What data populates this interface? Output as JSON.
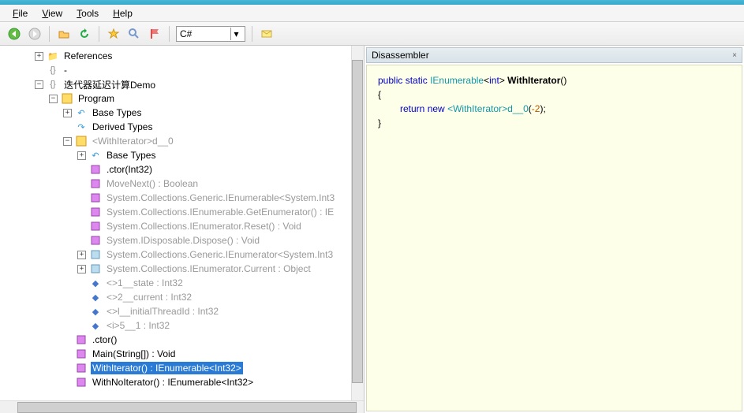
{
  "menu": {
    "file": "File",
    "view": "View",
    "tools": "Tools",
    "help": "Help"
  },
  "toolbar": {
    "combo_value": "C#"
  },
  "tree": {
    "references": "References",
    "dash": "-",
    "demo": "迭代器延迟计算Demo",
    "program": "Program",
    "base_types": "Base Types",
    "derived_types": "Derived Types",
    "withiterator_class": "<WithIterator>d__0",
    "base_types2": "Base Types",
    "ctor_int": ".ctor(Int32)",
    "movenext": "MoveNext() : Boolean",
    "sys_gen_ienum": "System.Collections.Generic.IEnumerable<System.Int3",
    "sys_ienum_get": "System.Collections.IEnumerable.GetEnumerator() : IE",
    "sys_ienum_reset": "System.Collections.IEnumerator.Reset() : Void",
    "sys_idisp": "System.IDisposable.Dispose() : Void",
    "sys_gen_ienumtr": "System.Collections.Generic.IEnumerator<System.Int3",
    "sys_ienum_cur": "System.Collections.IEnumerator.Current : Object",
    "state": "<>1__state : Int32",
    "current": "<>2__current : Int32",
    "threadid": "<>l__initialThreadId : Int32",
    "i5": "<i>5__1 : Int32",
    "ctor": ".ctor()",
    "main": "Main(String[]) : Void",
    "withiterator": "WithIterator() : IEnumerable<Int32>",
    "withnoiterator": "WithNoIterator() : IEnumerable<Int32>"
  },
  "panel": {
    "title": "Disassembler",
    "close": "×"
  },
  "code": {
    "l1_kw1": "public",
    "l1_kw2": "static",
    "l1_typ": "IEnumerable",
    "l1_kw3": "int",
    "l1_name": "WithIterator",
    "l2": "{",
    "l3_kw1": "return",
    "l3_kw2": "new",
    "l3_call": "<WithIterator>d__0",
    "l3_num": "-2",
    "l4": "}"
  }
}
